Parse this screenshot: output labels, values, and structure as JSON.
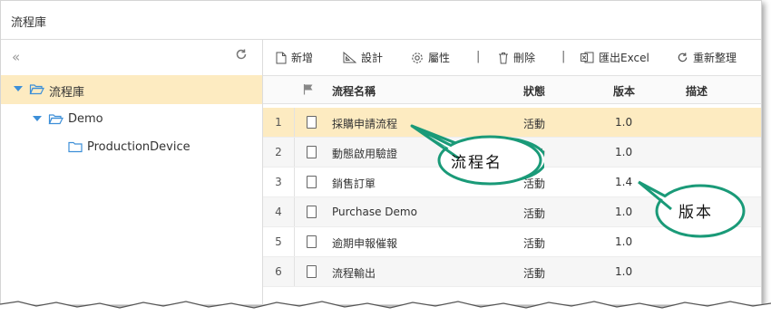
{
  "window": {
    "title": "流程庫"
  },
  "tree": {
    "collapse_icon": "double-chevron-left-icon",
    "refresh_icon": "refresh-icon",
    "nodes": [
      {
        "label": "流程庫",
        "level": 0,
        "expanded": true,
        "selected": true
      },
      {
        "label": "Demo",
        "level": 1,
        "expanded": true,
        "selected": false
      },
      {
        "label": "ProductionDevice",
        "level": 2,
        "expanded": false,
        "selected": false
      }
    ]
  },
  "toolbar": {
    "new_label": "新增",
    "design_label": "設計",
    "props_label": "屬性",
    "delete_label": "刪除",
    "export_label": "匯出Excel",
    "reorg_label": "重新整理"
  },
  "table": {
    "columns": [
      "流程名稱",
      "狀態",
      "版本",
      "描述"
    ],
    "rows": [
      {
        "index": "1",
        "name": "採購申請流程",
        "status": "活動",
        "version": "1.0",
        "desc": ""
      },
      {
        "index": "2",
        "name": "動態啟用驗證",
        "status": "活動",
        "version": "1.0",
        "desc": ""
      },
      {
        "index": "3",
        "name": "銷售訂單",
        "status": "活動",
        "version": "1.4",
        "desc": ""
      },
      {
        "index": "4",
        "name": "Purchase Demo",
        "status": "活動",
        "version": "1.0",
        "desc": ""
      },
      {
        "index": "5",
        "name": "逾期申報催報",
        "status": "活動",
        "version": "1.0",
        "desc": ""
      },
      {
        "index": "6",
        "name": "流程輸出",
        "status": "活動",
        "version": "1.0",
        "desc": ""
      }
    ]
  },
  "callouts": {
    "name_callout": "流程名",
    "version_callout": "版本"
  },
  "colors": {
    "selected_row": "#fdebc1",
    "folder": "#3d8fd8",
    "callout_border": "#1a9a78"
  }
}
